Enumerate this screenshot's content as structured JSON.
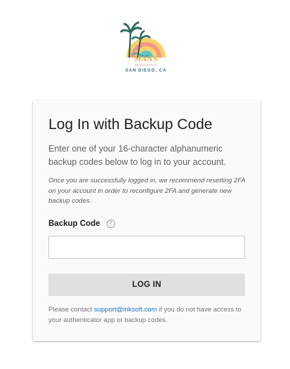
{
  "logo": {
    "brand": "MANS",
    "tagline": "BEACH SHACK",
    "location": "SAN DIEGO, CA"
  },
  "login": {
    "title": "Log In with Backup Code",
    "intro": "Enter one of your 16-character alphanumeric backup codes below to log in to your account.",
    "note": "Once you are successfully logged in, we recommend resetting 2FA on your account in order to reconfigure 2FA and generate new backup codes.",
    "field_label": "Backup Code",
    "help_icon_glyph": "?",
    "input_value": "",
    "button_label": "LOG IN",
    "footer_prefix": "Please contact ",
    "support_email": "support@inksoft.com",
    "footer_suffix": " if you do not have access to your authenticator app or backup codes."
  },
  "colors": {
    "link": "#1a73c8",
    "button_bg": "#e0e0e0",
    "card_bg": "#fafafa"
  },
  "icons": {
    "help": "question-circle-icon",
    "logo": "palm-tree-sunset-logo"
  }
}
